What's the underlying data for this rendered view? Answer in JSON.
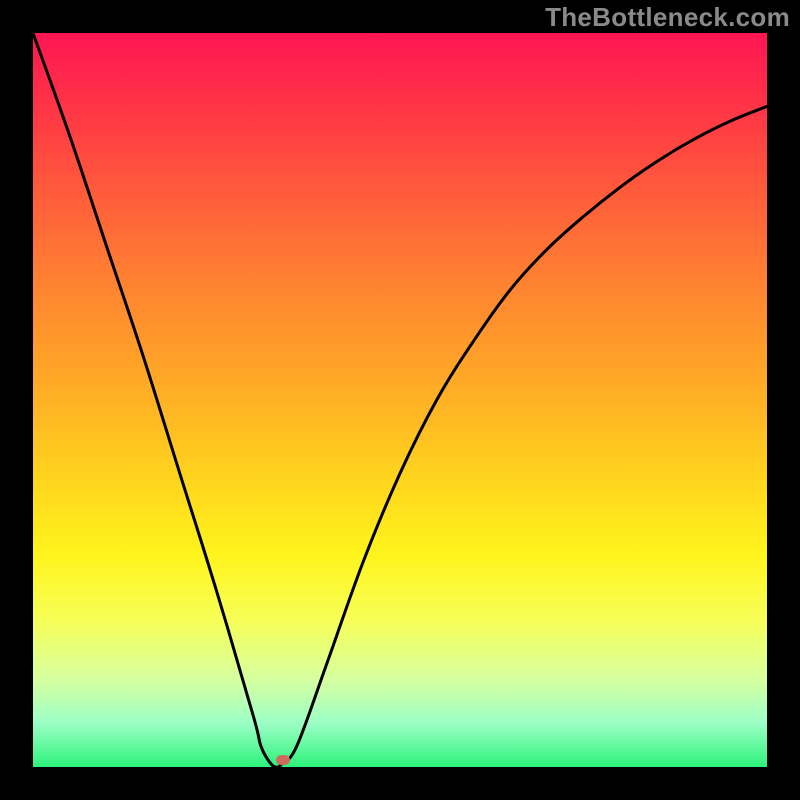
{
  "watermark": {
    "text": "TheBottleneck.com"
  },
  "colors": {
    "frame": "#000000",
    "gradient_top": "#ff1553",
    "gradient_bottom": "#2cf27a",
    "curve": "#000000",
    "marker": "#d06a5c"
  },
  "chart_data": {
    "type": "line",
    "title": "",
    "xlabel": "",
    "ylabel": "",
    "xlim": [
      0,
      100
    ],
    "ylim": [
      0,
      100
    ],
    "grid": false,
    "legend": false,
    "description": "V-shaped bottleneck curve; vertical axis is bottleneck percent (0 at bottom = green/good, 100 at top = red/bad). Minimum near x≈33.",
    "minimum": {
      "x": 33,
      "y": 0
    },
    "marker": {
      "x": 34,
      "y": 1
    },
    "series": [
      {
        "name": "bottleneck",
        "x": [
          0,
          5,
          10,
          15,
          20,
          25,
          30,
          31,
          32,
          33,
          34,
          36,
          40,
          45,
          50,
          55,
          60,
          65,
          70,
          75,
          80,
          85,
          90,
          95,
          100
        ],
        "values": [
          100,
          86,
          71,
          56,
          40,
          24,
          7,
          3,
          1,
          0,
          0.5,
          3,
          14,
          28,
          40,
          50,
          58,
          65,
          70.5,
          75,
          79,
          82.5,
          85.5,
          88,
          90
        ]
      }
    ]
  }
}
